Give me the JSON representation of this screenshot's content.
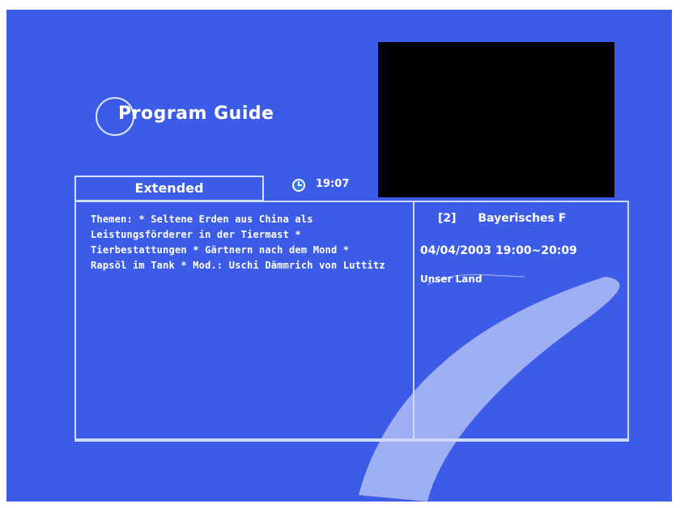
{
  "header": {
    "title": "Program Guide"
  },
  "tabs": {
    "extended_label": "Extended"
  },
  "clock": {
    "time": "19:07"
  },
  "description": {
    "text": "Themen:  * Seltene Erden aus China als Leistungsförderer in der Tiermast * Tierbestattungen  * Gärtnern nach dem Mond  * Rapsöl im Tank * Mod.: Uschi Dämmrich von Luttitz"
  },
  "channel": {
    "number": "[2]",
    "name": "Bayerisches F"
  },
  "program": {
    "datetime": "04/04/2003 19:00~20:09",
    "name": "Unser Land"
  },
  "colors": {
    "background": "#3c5be6",
    "text": "#ffffff",
    "border": "#cfd8ff",
    "video": "#000000"
  }
}
